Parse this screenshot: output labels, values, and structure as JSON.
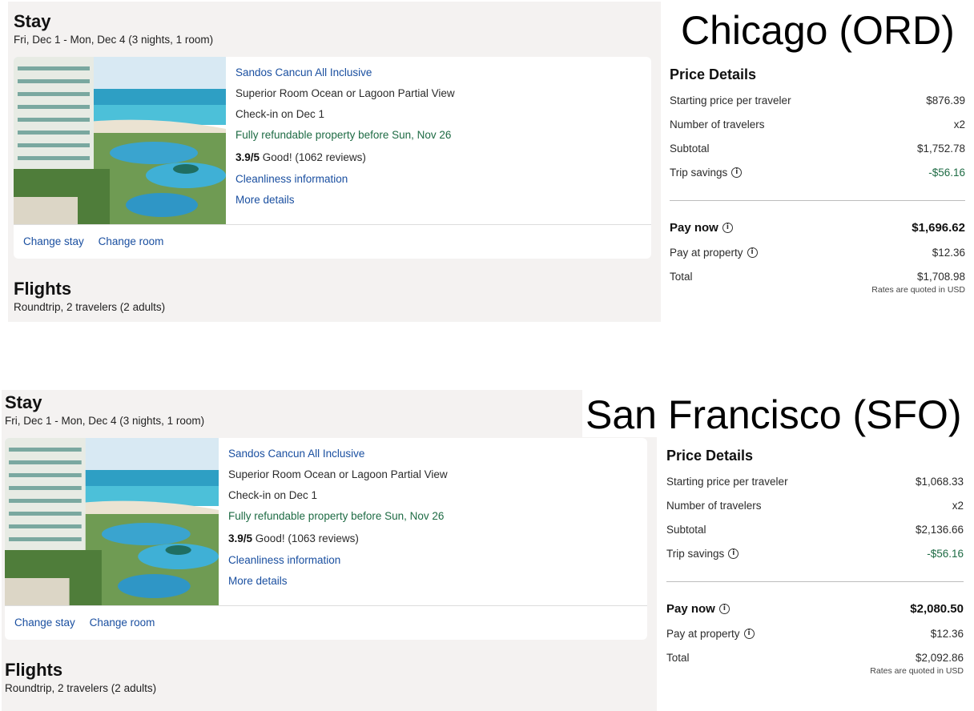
{
  "chicago": {
    "city_label": "Chicago (ORD)",
    "stay": {
      "title": "Stay",
      "dates": "Fri, Dec 1 - Mon, Dec 4 (3 nights, 1 room)"
    },
    "hotel": {
      "name": "Sandos Cancun All Inclusive",
      "room": "Superior Room Ocean or Lagoon Partial View",
      "checkin": "Check-in on Dec 1",
      "refund": "Fully refundable property before Sun, Nov 26",
      "rating": "3.9/5",
      "rating_text": "Good! (1062 reviews)",
      "cleanliness": "Cleanliness information",
      "more": "More details",
      "change_stay": "Change stay",
      "change_room": "Change room"
    },
    "flights": {
      "title": "Flights",
      "sub": "Roundtrip, 2 travelers (2 adults)"
    },
    "price": {
      "title": "Price Details",
      "starting_label": "Starting price per traveler",
      "starting_value": "$876.39",
      "travelers_label": "Number of travelers",
      "travelers_value": "x2",
      "subtotal_label": "Subtotal",
      "subtotal_value": "$1,752.78",
      "savings_label": "Trip savings",
      "savings_value": "-$56.16",
      "paynow_label": "Pay now",
      "paynow_value": "$1,696.62",
      "payprop_label": "Pay at property",
      "payprop_value": "$12.36",
      "total_label": "Total",
      "total_value": "$1,708.98",
      "note": "Rates are quoted in USD"
    }
  },
  "sanfrancisco": {
    "city_label": "San Francisco (SFO)",
    "stay": {
      "title": "Stay",
      "dates": "Fri, Dec 1 - Mon, Dec 4 (3 nights, 1 room)"
    },
    "hotel": {
      "name": "Sandos Cancun All Inclusive",
      "room": "Superior Room Ocean or Lagoon Partial View",
      "checkin": "Check-in on Dec 1",
      "refund": "Fully refundable property before Sun, Nov 26",
      "rating": "3.9/5",
      "rating_text": "Good! (1063 reviews)",
      "cleanliness": "Cleanliness information",
      "more": "More details",
      "change_stay": "Change stay",
      "change_room": "Change room"
    },
    "flights": {
      "title": "Flights",
      "sub": "Roundtrip, 2 travelers (2 adults)"
    },
    "price": {
      "title": "Price Details",
      "starting_label": "Starting price per traveler",
      "starting_value": "$1,068.33",
      "travelers_label": "Number of travelers",
      "travelers_value": "x2",
      "subtotal_label": "Subtotal",
      "subtotal_value": "$2,136.66",
      "savings_label": "Trip savings",
      "savings_value": "-$56.16",
      "paynow_label": "Pay now",
      "paynow_value": "$2,080.50",
      "payprop_label": "Pay at property",
      "payprop_value": "$12.36",
      "total_label": "Total",
      "total_value": "$2,092.86",
      "note": "Rates are quoted in USD"
    }
  }
}
